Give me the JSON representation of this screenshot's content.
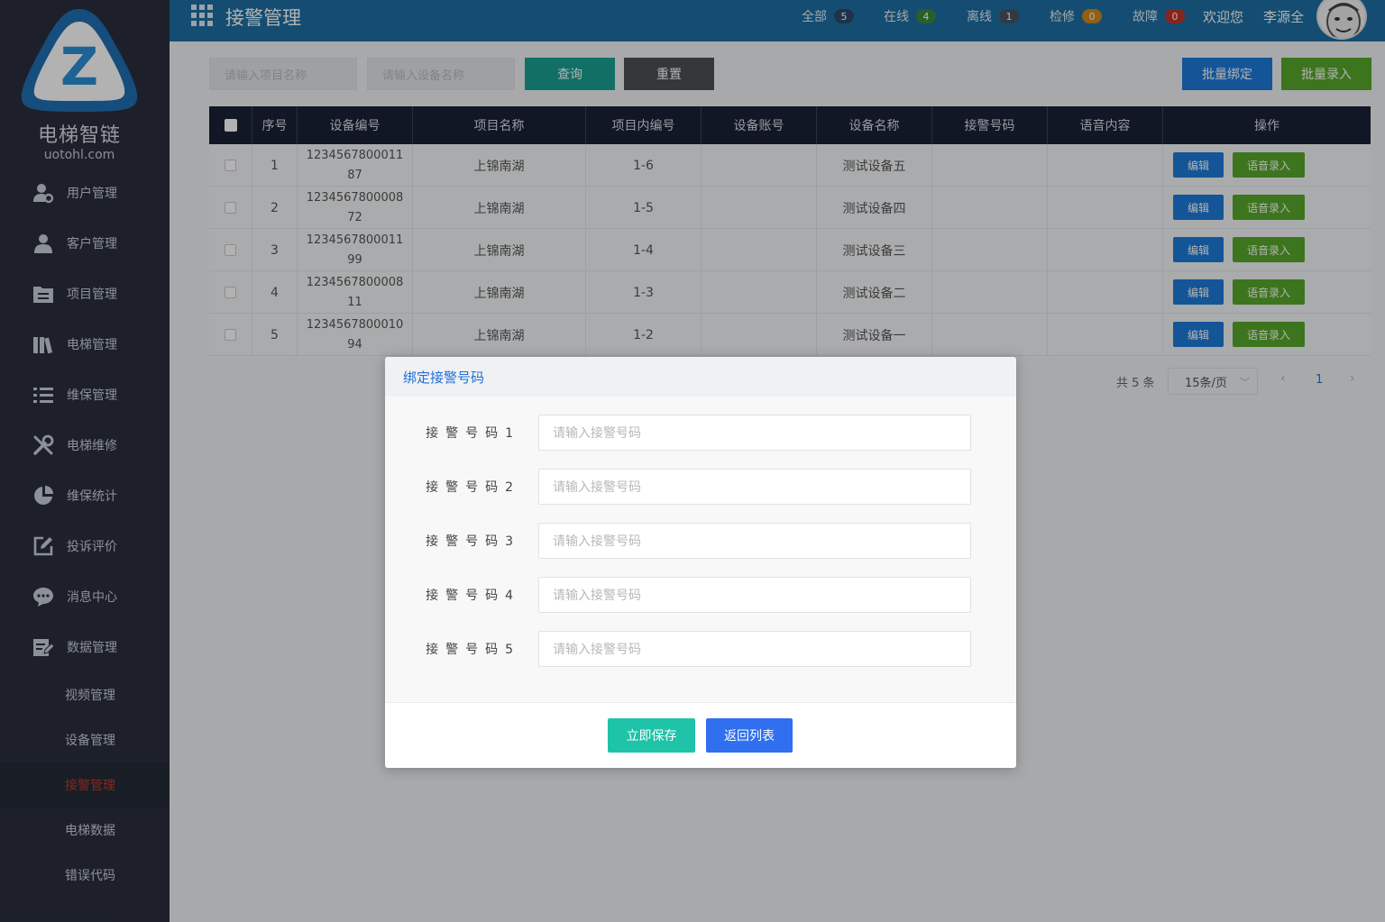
{
  "colors": {
    "sidebar_bg": "#2a2f3d",
    "topbar_bg": "#1e6fa3",
    "teal": "#1aa093",
    "gray_btn": "#4e4f53",
    "blue_btn": "#1e7ad8",
    "green_btn": "#57a82a",
    "active_menu_text": "#c0392b"
  },
  "brand": {
    "name": "电梯智链",
    "url": "uotohl.com",
    "logo_letter": "Z"
  },
  "sidebar": {
    "menu": [
      {
        "label": "用户管理",
        "icon": "user-gear-icon"
      },
      {
        "label": "客户管理",
        "icon": "user-icon"
      },
      {
        "label": "项目管理",
        "icon": "folder-icon"
      },
      {
        "label": "电梯管理",
        "icon": "books-icon"
      },
      {
        "label": "维保管理",
        "icon": "list-icon"
      },
      {
        "label": "电梯维修",
        "icon": "tools-icon"
      },
      {
        "label": "维保统计",
        "icon": "pie-chart-icon"
      },
      {
        "label": "投诉评价",
        "icon": "edit-icon"
      },
      {
        "label": "消息中心",
        "icon": "chat-icon"
      },
      {
        "label": "数据管理",
        "icon": "data-edit-icon"
      }
    ],
    "submenu": [
      {
        "label": "视频管理"
      },
      {
        "label": "设备管理"
      },
      {
        "label": "接警管理",
        "active": true
      },
      {
        "label": "电梯数据"
      },
      {
        "label": "错误代码"
      }
    ]
  },
  "header": {
    "title": "接警管理",
    "stats": [
      {
        "label": "全部",
        "count": "5",
        "color": "#2c4a66"
      },
      {
        "label": "在线",
        "count": "4",
        "color": "#3c8a3c"
      },
      {
        "label": "离线",
        "count": "1",
        "color": "#4a5260"
      },
      {
        "label": "检修",
        "count": "0",
        "color": "#d08a1e"
      },
      {
        "label": "故障",
        "count": "0",
        "color": "#c43428"
      }
    ],
    "welcome": "欢迎您",
    "username": "李源全"
  },
  "search": {
    "project_placeholder": "请输入项目名称",
    "device_placeholder": "请输入设备名称",
    "query_label": "查询",
    "reset_label": "重置",
    "batch_bind_label": "批量绑定",
    "batch_import_label": "批量录入"
  },
  "table": {
    "columns": [
      "序号",
      "设备编号",
      "项目名称",
      "项目内编号",
      "设备账号",
      "设备名称",
      "接警号码",
      "语音内容",
      "操作"
    ],
    "rows": [
      {
        "index": "1",
        "device_id": "123456780001187",
        "project": "上锦南湖",
        "inner_no": "1-6",
        "account": "",
        "device_name": "测试设备五",
        "alarm_no": "",
        "voice": ""
      },
      {
        "index": "2",
        "device_id": "123456780000872",
        "project": "上锦南湖",
        "inner_no": "1-5",
        "account": "",
        "device_name": "测试设备四",
        "alarm_no": "",
        "voice": ""
      },
      {
        "index": "3",
        "device_id": "123456780001199",
        "project": "上锦南湖",
        "inner_no": "1-4",
        "account": "",
        "device_name": "测试设备三",
        "alarm_no": "",
        "voice": ""
      },
      {
        "index": "4",
        "device_id": "123456780000811",
        "project": "上锦南湖",
        "inner_no": "1-3",
        "account": "",
        "device_name": "测试设备二",
        "alarm_no": "",
        "voice": ""
      },
      {
        "index": "5",
        "device_id": "123456780001094",
        "project": "上锦南湖",
        "inner_no": "1-2",
        "account": "",
        "device_name": "测试设备一",
        "alarm_no": "",
        "voice": ""
      }
    ],
    "edit_label": "编辑",
    "voice_label": "语音录入"
  },
  "pagination": {
    "total": "共 5 条",
    "page_size": "15条/页",
    "current_page": "1",
    "prev": "‹",
    "next": "›"
  },
  "modal": {
    "title": "绑定接警号码",
    "fields": [
      {
        "label": "接警号码1",
        "placeholder": "请输入接警号码"
      },
      {
        "label": "接警号码2",
        "placeholder": "请输入接警号码"
      },
      {
        "label": "接警号码3",
        "placeholder": "请输入接警号码"
      },
      {
        "label": "接警号码4",
        "placeholder": "请输入接警号码"
      },
      {
        "label": "接警号码5",
        "placeholder": "请输入接警号码"
      }
    ],
    "save_label": "立即保存",
    "back_label": "返回列表"
  }
}
